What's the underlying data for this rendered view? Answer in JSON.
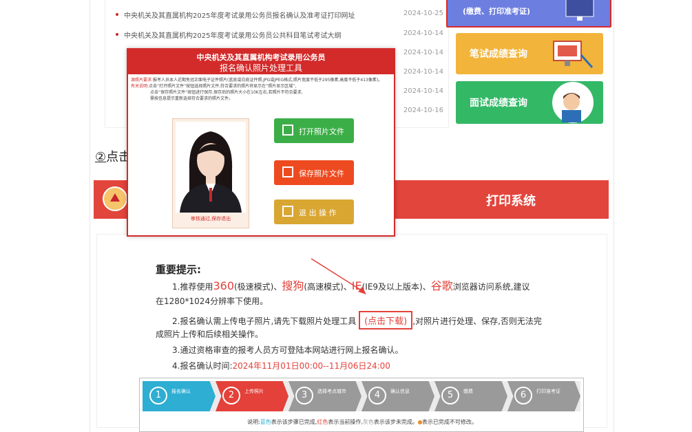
{
  "news": [
    {
      "title": "中央机关及其直属机构2025年度考试录用公务员报名确认及准考证打印网址",
      "date": "2024-10-25"
    },
    {
      "title": "中央机关及其直属机构2025年度考试录用公务员公共科目笔试考试大纲",
      "date": "2024-10-14"
    },
    {
      "title": "",
      "date": "2024-10-14"
    },
    {
      "title": "",
      "date": "2024-10-14"
    },
    {
      "title": "",
      "date": "2024-10-14"
    },
    {
      "title": "",
      "date": "2024-10-14"
    },
    {
      "title": "",
      "date": "2024-10-16"
    }
  ],
  "tiles": {
    "top_label": "(缴费、打印准考证)",
    "exam_label": "笔试成绩查询",
    "interview_label": "面试成绩查询"
  },
  "step2": {
    "num": "②",
    "text": "点击"
  },
  "banner": {
    "system_text": "打印系统"
  },
  "dialog": {
    "title_line1": "中央机关及其直属机构考试录用公务员",
    "title_line2": "报名确认照片处理工具",
    "req_key": "源照片要求:",
    "req_text": "报考人员本人近期免冠正面电子证件照片(蓝底或白底证件照,JPG或JPEG格式,照片宽度不低于295像素,高度不低于413像素)。",
    "info_key": "有关说明:",
    "info_text1": "点击“打开照片文件”按钮选择照片文件,符合要求的照片将显示在“照片显示区域”,",
    "info_text2": "点击“保存照片文件”按钮进行保存,保存后的照片大小在10K左右,若照片不符合要求,",
    "info_text3": "需按信息提示重新选择符合要求的照片文件。",
    "photo_caption": "审核通过,保存退出",
    "open_label": "打开照片文件",
    "save_label": "保存照片文件",
    "exit_label": "退 出 操 作"
  },
  "notice": {
    "title": "重要提示:",
    "l1_a": "1.推荐使用",
    "l1_360": "360",
    "l1_b": "(极速模式)、",
    "l1_sougou": "搜狗",
    "l1_c": "(高速模式)、",
    "l1_ie": "IE",
    "l1_d": "(IE9及以上版本)、",
    "l1_chrome": "谷歌",
    "l1_e": "浏览器访问系统,建议",
    "l1_f": "在1280*1024分辨率下使用。",
    "l2_a": "2.报名确认需上传电子照片,请先下载照片处理工具",
    "l2_link": "(点击下载)",
    "l2_b": ",对照片进行处理、保存,否则无法完",
    "l2_c": "成照片上传和后续相关操作。",
    "l3": "3.通过资格审查的报考人员方可登陆本网站进行网上报名确认。",
    "l4_a": "4.报名确认时间:",
    "l4_time": "2024年11月01日00:00--11月06日24:00"
  },
  "steps": [
    {
      "num": "1",
      "label": "报名确认",
      "color": "#2eaed3"
    },
    {
      "num": "2",
      "label": "上传照片",
      "color": "#e3413a"
    },
    {
      "num": "3",
      "label": "选择考点城市",
      "color": "#9a9a9a"
    },
    {
      "num": "4",
      "label": "确认信息",
      "color": "#9a9a9a"
    },
    {
      "num": "5",
      "label": "缴费",
      "color": "#9a9a9a"
    },
    {
      "num": "6",
      "label": "打印准考证",
      "color": "#9a9a9a"
    }
  ],
  "legend": {
    "a": "说明:",
    "blue": "蓝色",
    "b": "表示该步骤已完成,",
    "red": "红色",
    "c": "表示当前操作,",
    "gray": "灰色",
    "d": "表示该步未完成。",
    "e": "表示已完成不可修改。"
  },
  "colors": {
    "brand_red": "#d32a2a",
    "open_green": "#3cae47",
    "save_orange": "#ee4a20",
    "exit_gold": "#d9a632"
  }
}
